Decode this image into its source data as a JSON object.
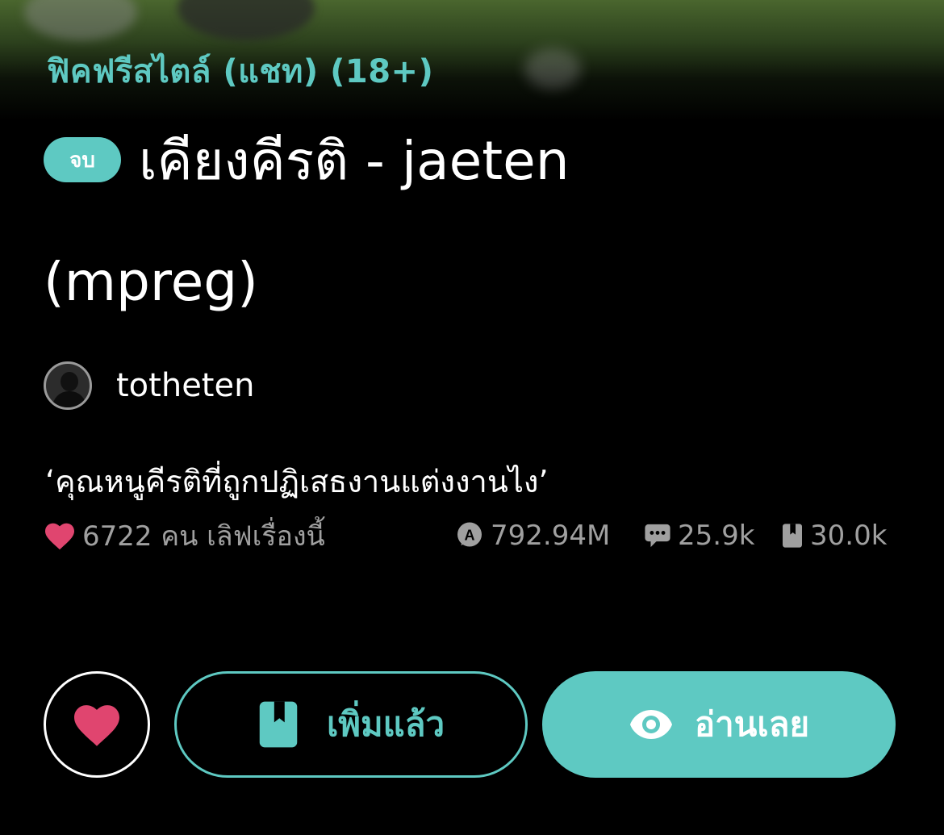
{
  "category": "ฟิคฟรีสไตล์ (แชท) (18+)",
  "status_badge": "จบ",
  "title": {
    "line1": "เคียงคีรติ - jaeten",
    "line2": "(mpreg)"
  },
  "author": {
    "name": "totheten"
  },
  "tagline": "‘คุณหนูคีรติที่ถูกปฏิเสธงานแต่งงานไง’",
  "stats": {
    "likes_text": "6722 คน เลิฟเรื่องนี้",
    "views": "792.94M",
    "comments": "25.9k",
    "bookmarks": "30.0k"
  },
  "actions": {
    "added_label": "เพิ่มแล้ว",
    "read_label": "อ่านเลย"
  },
  "colors": {
    "accent": "#5ec9c2",
    "heart": "#e0456f",
    "muted_text": "#a0a0a0",
    "background": "#000000"
  },
  "icons": {
    "heart": "heart-icon",
    "views": "views-icon",
    "comments": "comment-icon",
    "bookmarks": "bookmark-icon",
    "eye": "eye-icon"
  }
}
